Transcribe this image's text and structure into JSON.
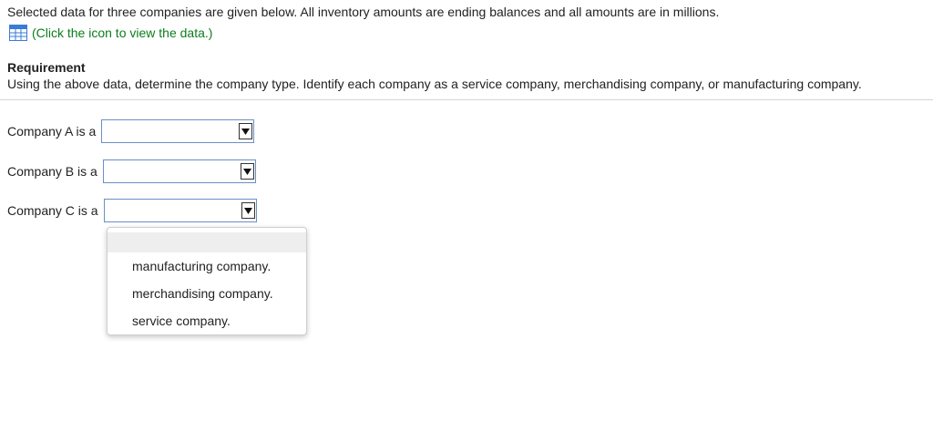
{
  "intro": {
    "text": "Selected data for three companies are given below. All inventory amounts are ending balances and all amounts are in millions."
  },
  "data_link": {
    "icon": "table-grid-icon",
    "label": "(Click the icon to view the data.)",
    "color": "#0b7d1c"
  },
  "requirement": {
    "heading": "Requirement",
    "text": "Using the above data, determine the company type. Identify each company as a service company, merchandising company, or manufacturing company."
  },
  "rows": [
    {
      "label": "Company A is a",
      "selected": ""
    },
    {
      "label": "Company B is a",
      "selected": ""
    },
    {
      "label": "Company C is a",
      "selected": ""
    }
  ],
  "dropdown": {
    "options": [
      "manufacturing company.",
      "merchandising company.",
      "service company."
    ]
  },
  "colors": {
    "select_border": "#6b8fc6",
    "link_green": "#0b7d1c",
    "icon_blue": "#3a7bd5"
  }
}
